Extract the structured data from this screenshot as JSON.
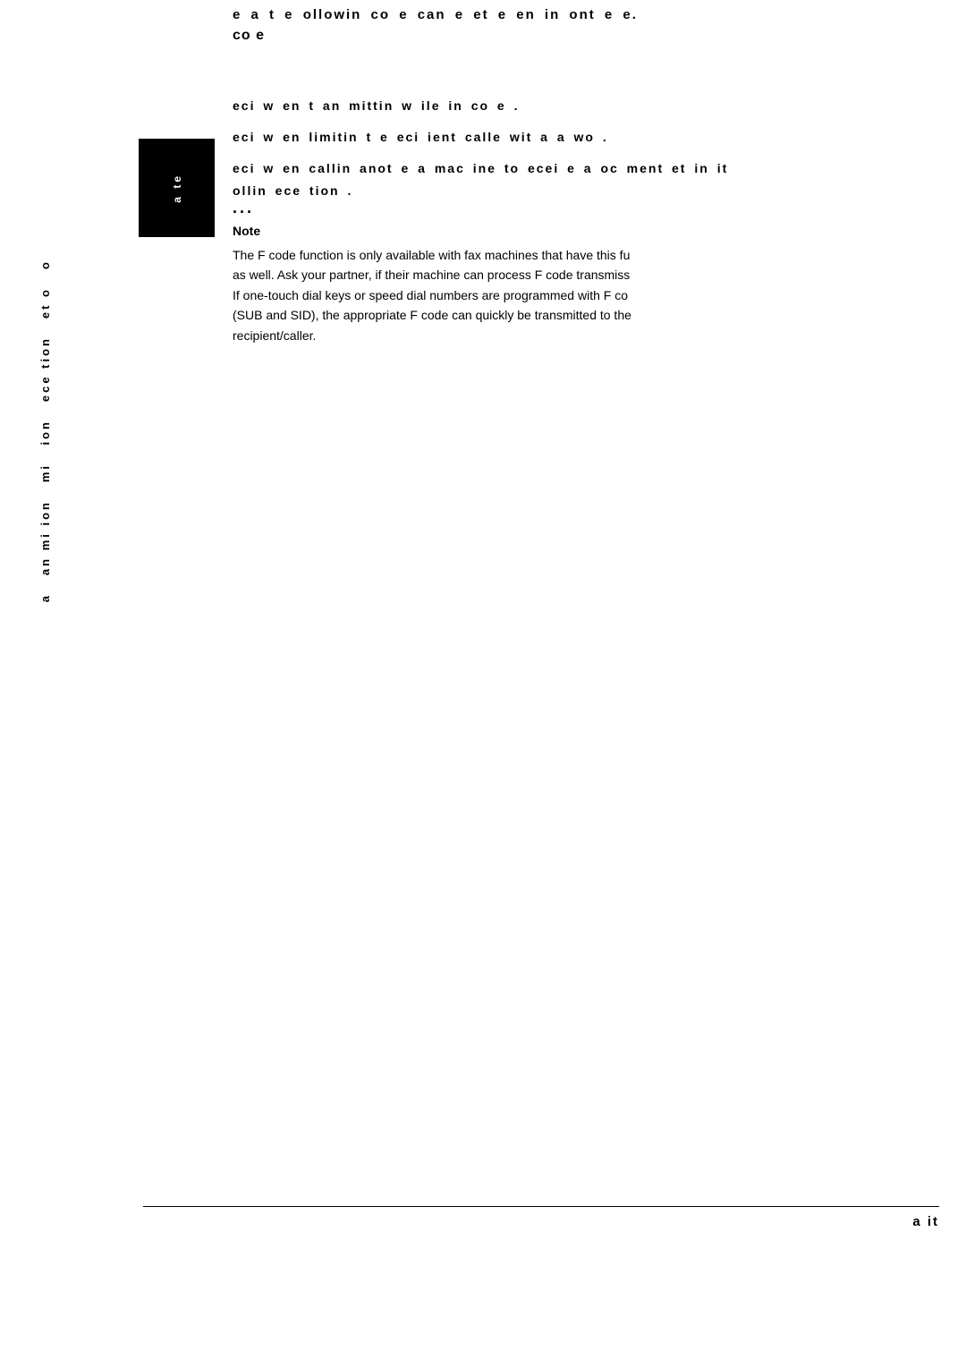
{
  "header": {
    "line1": "e  a  t e  ollowin    co e  can  e  et   e en in  ont e   e.",
    "line2": "co e"
  },
  "spec_lines": {
    "line1": "eci   w en t an  mittin  w ile   in    co e .",
    "line2": "eci   w en limitin   t e  eci ient calle  wit  a  a   wo  .",
    "line3": "eci   w en callin   anot e   a  mac ine to  ecei e a  oc ment  et    in it",
    "line3b": "ollin   ece tion ."
  },
  "left_tab": {
    "text": "a te"
  },
  "dots": "...",
  "note": {
    "label": "Note",
    "text1": "The F code function is only available with fax machines that have this fu",
    "text2": "as well. Ask your partner, if their machine can process F code transmiss",
    "text3": "If one-touch dial keys or speed dial numbers are programmed with F co",
    "text4": "(SUB and SID), the appropriate F code can quickly be transmitted to the",
    "text5": "recipient/caller."
  },
  "sidebar": {
    "lines": [
      "o",
      "et o",
      "ece tion",
      "ion",
      "mi",
      "an mi ion",
      "a"
    ]
  },
  "bottom_label": "a   it"
}
